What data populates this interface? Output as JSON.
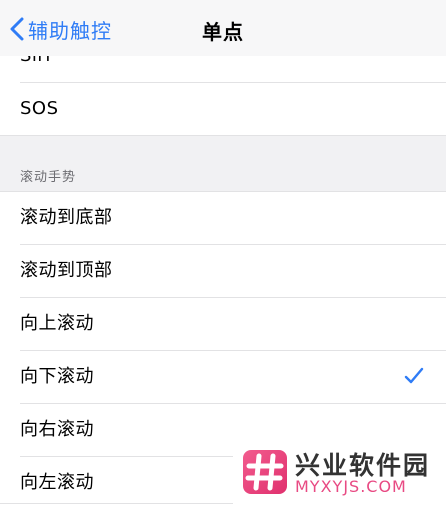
{
  "nav": {
    "back_label": "辅助触控",
    "title": "单点"
  },
  "rows_top": [
    {
      "label": "Siri"
    },
    {
      "label": "SOS"
    }
  ],
  "section": {
    "header": "滚动手势"
  },
  "scroll_items": [
    {
      "label": "滚动到底部",
      "selected": false
    },
    {
      "label": "滚动到顶部",
      "selected": false
    },
    {
      "label": "向上滚动",
      "selected": false
    },
    {
      "label": "向下滚动",
      "selected": true
    },
    {
      "label": "向右滚动",
      "selected": false
    },
    {
      "label": "向左滚动",
      "selected": false
    }
  ],
  "colors": {
    "accent": "#2f7cf6",
    "watermark_pink": "#e84a83"
  },
  "watermark": {
    "name": "兴业软件园",
    "url": "MYXYJS.COM"
  }
}
